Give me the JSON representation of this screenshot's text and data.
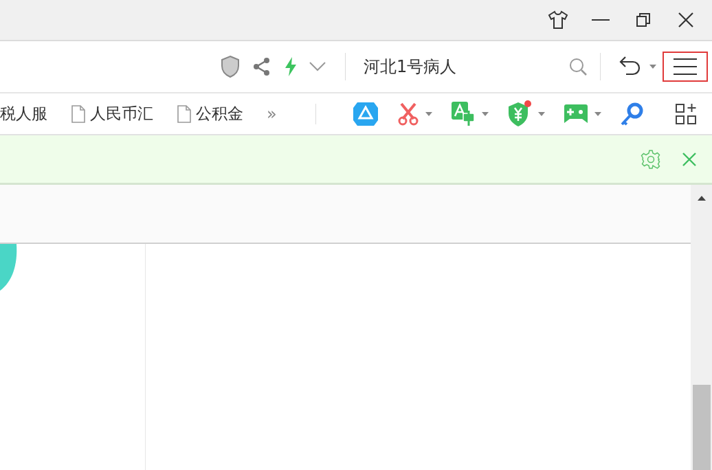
{
  "address_bar": {
    "search_value": "河北1号病人",
    "menu_button": {
      "highlighted": true
    }
  },
  "bookmarks": [
    {
      "kind": "text",
      "label": "税人服"
    },
    {
      "kind": "page",
      "label": "人民币汇"
    },
    {
      "kind": "page",
      "label": "公积金"
    }
  ],
  "bookmarks_more": "»",
  "extensions": [
    {
      "kind": "cloud",
      "dropdown": false,
      "badge": false
    },
    {
      "kind": "scissors",
      "dropdown": true,
      "badge": false
    },
    {
      "kind": "translate",
      "dropdown": true,
      "badge": false
    },
    {
      "kind": "money-shield",
      "dropdown": true,
      "badge": true
    },
    {
      "kind": "gamepad",
      "dropdown": true,
      "badge": false
    },
    {
      "kind": "key",
      "dropdown": false,
      "badge": false
    },
    {
      "kind": "apps",
      "dropdown": false,
      "badge": false
    }
  ]
}
